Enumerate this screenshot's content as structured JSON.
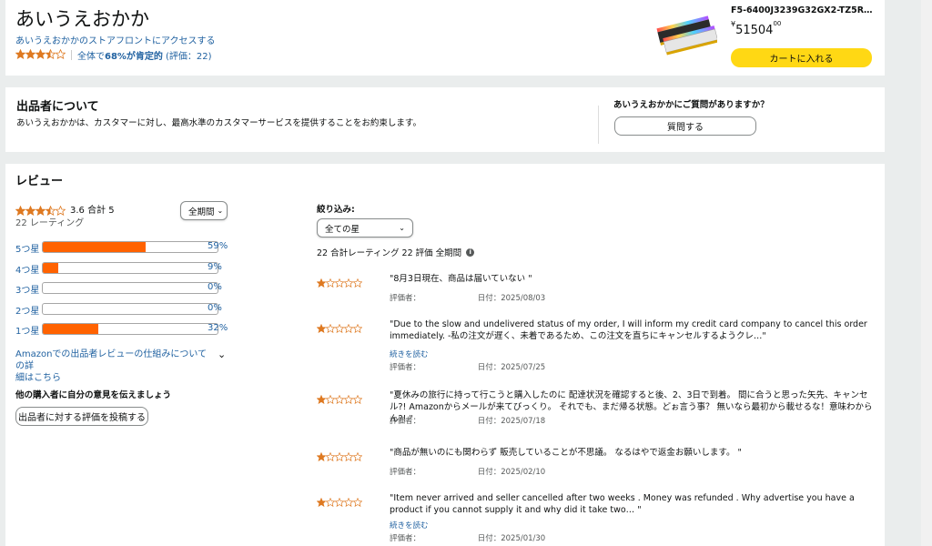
{
  "seller": {
    "name": "あいうえおかか",
    "storefront_link": "あいうえおかかのストアフロントにアクセスする",
    "rating_summary_prefix": "全体で",
    "rating_summary_pct": "68%が肯定的",
    "rating_summary_suffix": "(評価：22)",
    "stars": 3.5
  },
  "product": {
    "title": "F5-6400J3239G32GX2-TZ5R…",
    "price_symbol": "¥",
    "price_main": "51504",
    "price_fraction": "00",
    "cart_button": "カートに入れる"
  },
  "about": {
    "heading": "出品者について",
    "description": "あいうえおかかは、カスタマーに対し、最高水準のカスタマーサービスを提供することをお約束します。",
    "question_heading": "あいうえおかかにご質問がありますか？",
    "question_button": "質問する"
  },
  "reviews": {
    "heading": "レビュー",
    "stars": 3.5,
    "avg": "3.6 合計 5",
    "count_label": "22 レーティング",
    "period_select": "全期間",
    "histogram": [
      {
        "label": "5つ星",
        "pct": "59%",
        "value": 59
      },
      {
        "label": "4つ星",
        "pct": "9%",
        "value": 9
      },
      {
        "label": "3つ星",
        "pct": "0%",
        "value": 0
      },
      {
        "label": "2つ星",
        "pct": "0%",
        "value": 0
      },
      {
        "label": "1つ星",
        "pct": "32%",
        "value": 32
      }
    ],
    "how_it_works_line1": "Amazonでの出品者レビューの仕組みについての詳",
    "how_it_works_line2": "細はこちら",
    "share_heading": "他の購入者に自分の意見を伝えましょう",
    "share_button": "出品者に対する評価を投稿する",
    "filter_label": "絞り込み:",
    "filter_select": "全ての星",
    "filter_summary": "22 合計レーティング 22 評価 全期間",
    "items": [
      {
        "text": "\"8月3日現在、商品は届いていない \"",
        "reviewer": "評価者：",
        "date": "日付：2025/08/03",
        "stars": 1,
        "more": ""
      },
      {
        "text": "\"Due to the slow and undelivered status of my order, I will inform my credit card company to cancel this order immediately. -私の注文が遅く、未着であるため、この注文を直ちにキャンセルするようクレ…\"",
        "reviewer": "評価者：",
        "date": "日付：2025/07/25",
        "stars": 1,
        "more": "続きを読む"
      },
      {
        "text": "\"夏休みの旅行に持って行こうと購入したのに 配達状況を確認すると後、2、3日で到着。 間に合うと思った矢先、キャンセル?! Amazonからメールが来てびっくり。 それでも、まだ帰る状態。どぉ言う事？ 無いなら最初から載せるな！意味わからん?! \"",
        "reviewer": "評価者：",
        "date": "日付：2025/07/18",
        "stars": 1,
        "more": ""
      },
      {
        "text": "\"商品が無いのにも関わらず 販売していることが不思議。 なるはやで返金お願いします。 \"",
        "reviewer": "評価者：",
        "date": "日付：2025/02/10",
        "stars": 1,
        "more": ""
      },
      {
        "text": "\"Item never arrived and seller cancelled after two weeks . Money was refunded . Why advertise you have a product if you cannot supply it and why did it take two… \"",
        "reviewer": "評価者：",
        "date": "日付：2025/01/30",
        "stars": 1,
        "more": "続きを読む"
      }
    ]
  },
  "colors": {
    "star": "#de7921",
    "bar": "#ff6200",
    "link": "#2162a1",
    "cart": "#ffd814"
  }
}
